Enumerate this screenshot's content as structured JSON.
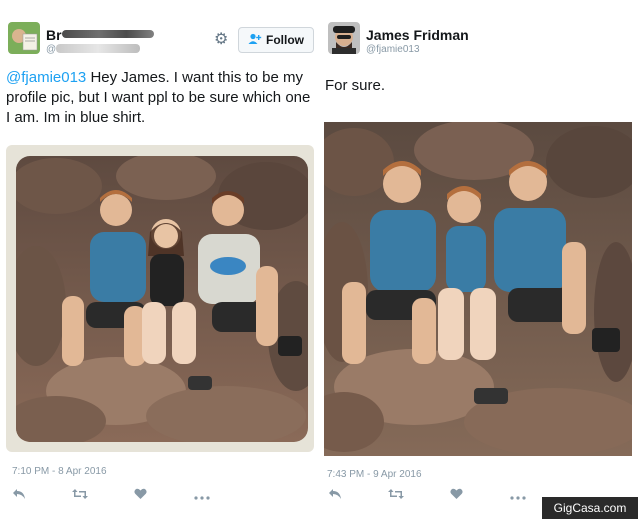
{
  "left_tweet": {
    "name_visible": "Br",
    "handle_visible": "@B",
    "follow_label": "Follow",
    "text_mention": "@fjamie013",
    "text_body": " Hey James. I want this to be my profile pic, but I want ppl to be sure which one I am. Im in blue shirt.",
    "timestamp": "7:10 PM - 8 Apr 2016",
    "icons": [
      "reply-icon",
      "retweet-icon",
      "like-icon",
      "more-icon"
    ]
  },
  "right_tweet": {
    "name": "James Fridman",
    "handle": "@fjamie013",
    "text": "For sure.",
    "timestamp": "7:43 PM - 9 Apr 2016",
    "icons": [
      "reply-icon",
      "retweet-icon",
      "like-icon",
      "more-icon"
    ]
  },
  "watermark": "GigCasa.com",
  "colors": {
    "link_blue": "#1da1f2",
    "muted_gray": "#8899a6",
    "text_dark": "#14171a",
    "shirt_blue": "#3a7ca5",
    "rock_brown": "#7a5a4a"
  }
}
